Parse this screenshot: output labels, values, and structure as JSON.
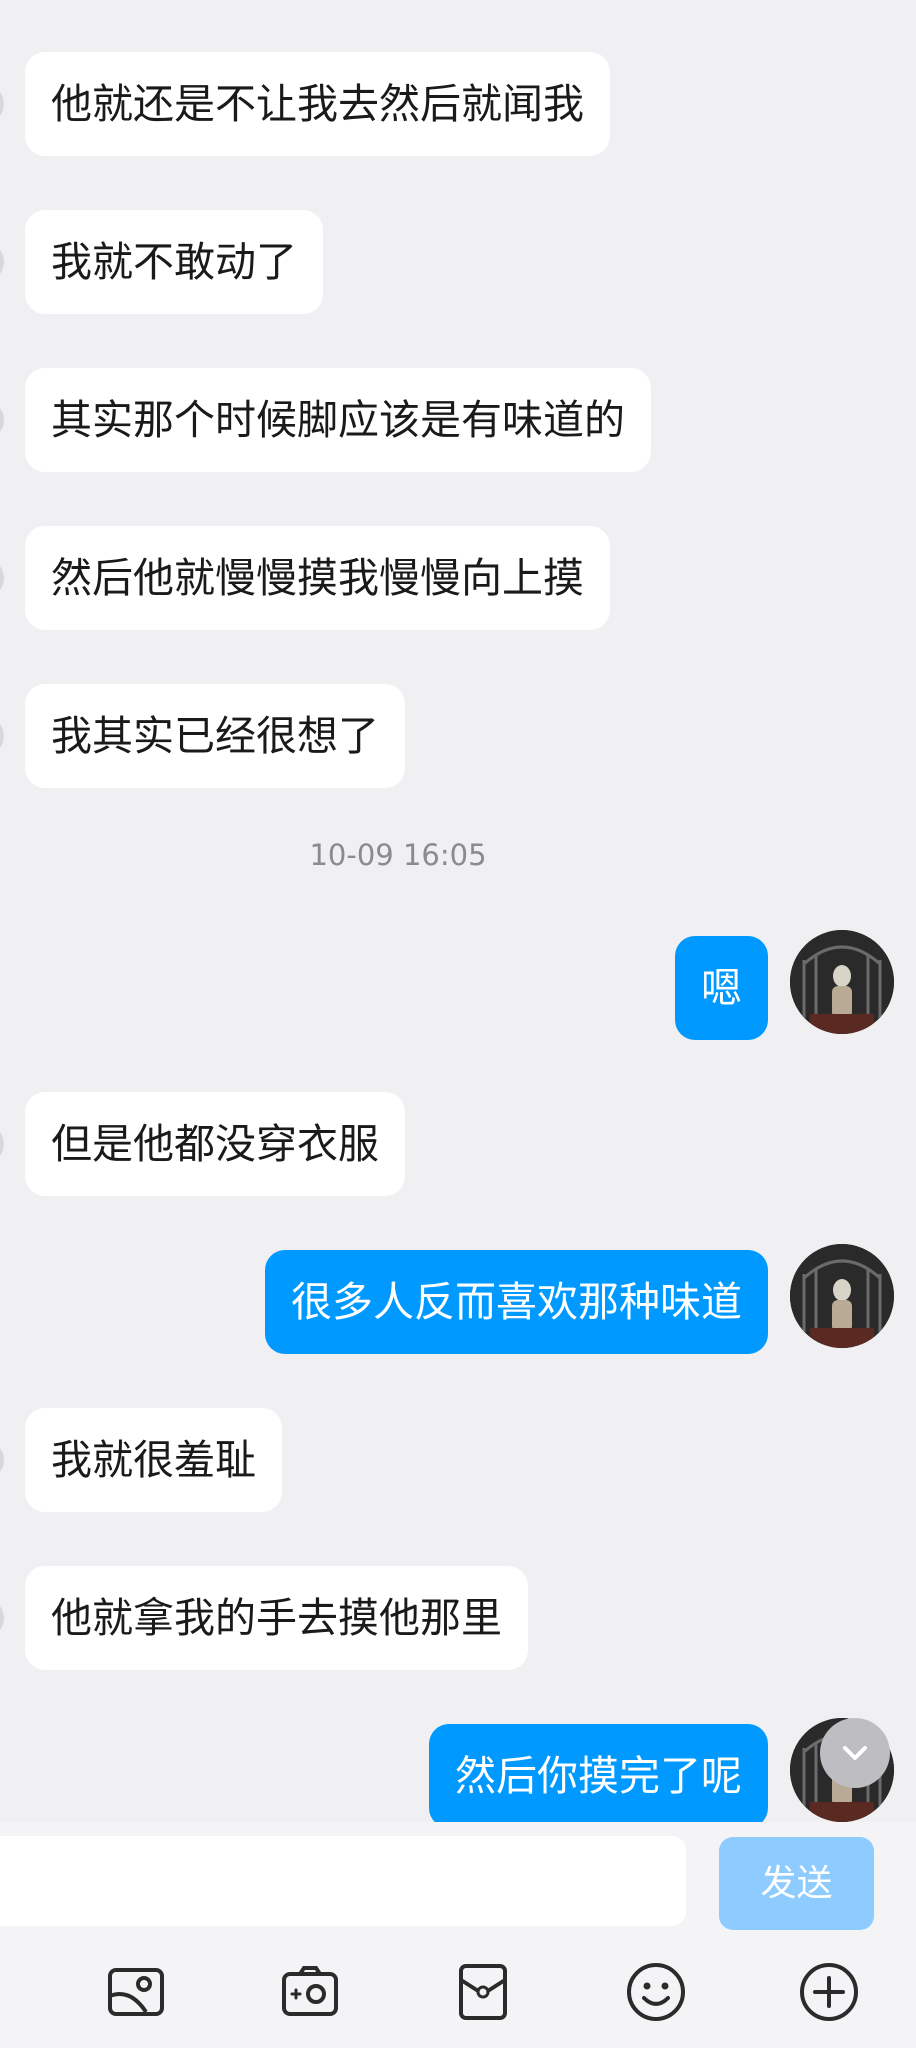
{
  "messages": [
    {
      "side": "in",
      "text": "他就还是不让我去然后就闻我"
    },
    {
      "side": "in",
      "text": "我就不敢动了"
    },
    {
      "side": "in",
      "text": "其实那个时候脚应该是有味道的"
    },
    {
      "side": "in",
      "text": "然后他就慢慢摸我慢慢向上摸"
    },
    {
      "side": "in",
      "text": "我其实已经很想了"
    },
    {
      "side": "out",
      "text": "嗯"
    },
    {
      "side": "in",
      "text": "但是他都没穿衣服"
    },
    {
      "side": "out",
      "text": "很多人反而喜欢那种味道"
    },
    {
      "side": "in",
      "text": "我就很羞耻"
    },
    {
      "side": "in",
      "text": "他就拿我的手去摸他那里"
    },
    {
      "side": "out",
      "text": "然后你摸完了呢"
    }
  ],
  "timestamp": "10-09 16:05",
  "input": {
    "value": "",
    "placeholder": ""
  },
  "send_label": "发送",
  "toolbar": [
    {
      "icon": "image-icon"
    },
    {
      "icon": "camera-icon"
    },
    {
      "icon": "red-packet-icon"
    },
    {
      "icon": "emoji-icon"
    },
    {
      "icon": "plus-icon"
    }
  ],
  "colors": {
    "outgoing_bubble": "#0099ff",
    "incoming_bubble": "#ffffff",
    "background": "#f0f0f2",
    "send_button_disabled": "#8ecbff"
  }
}
